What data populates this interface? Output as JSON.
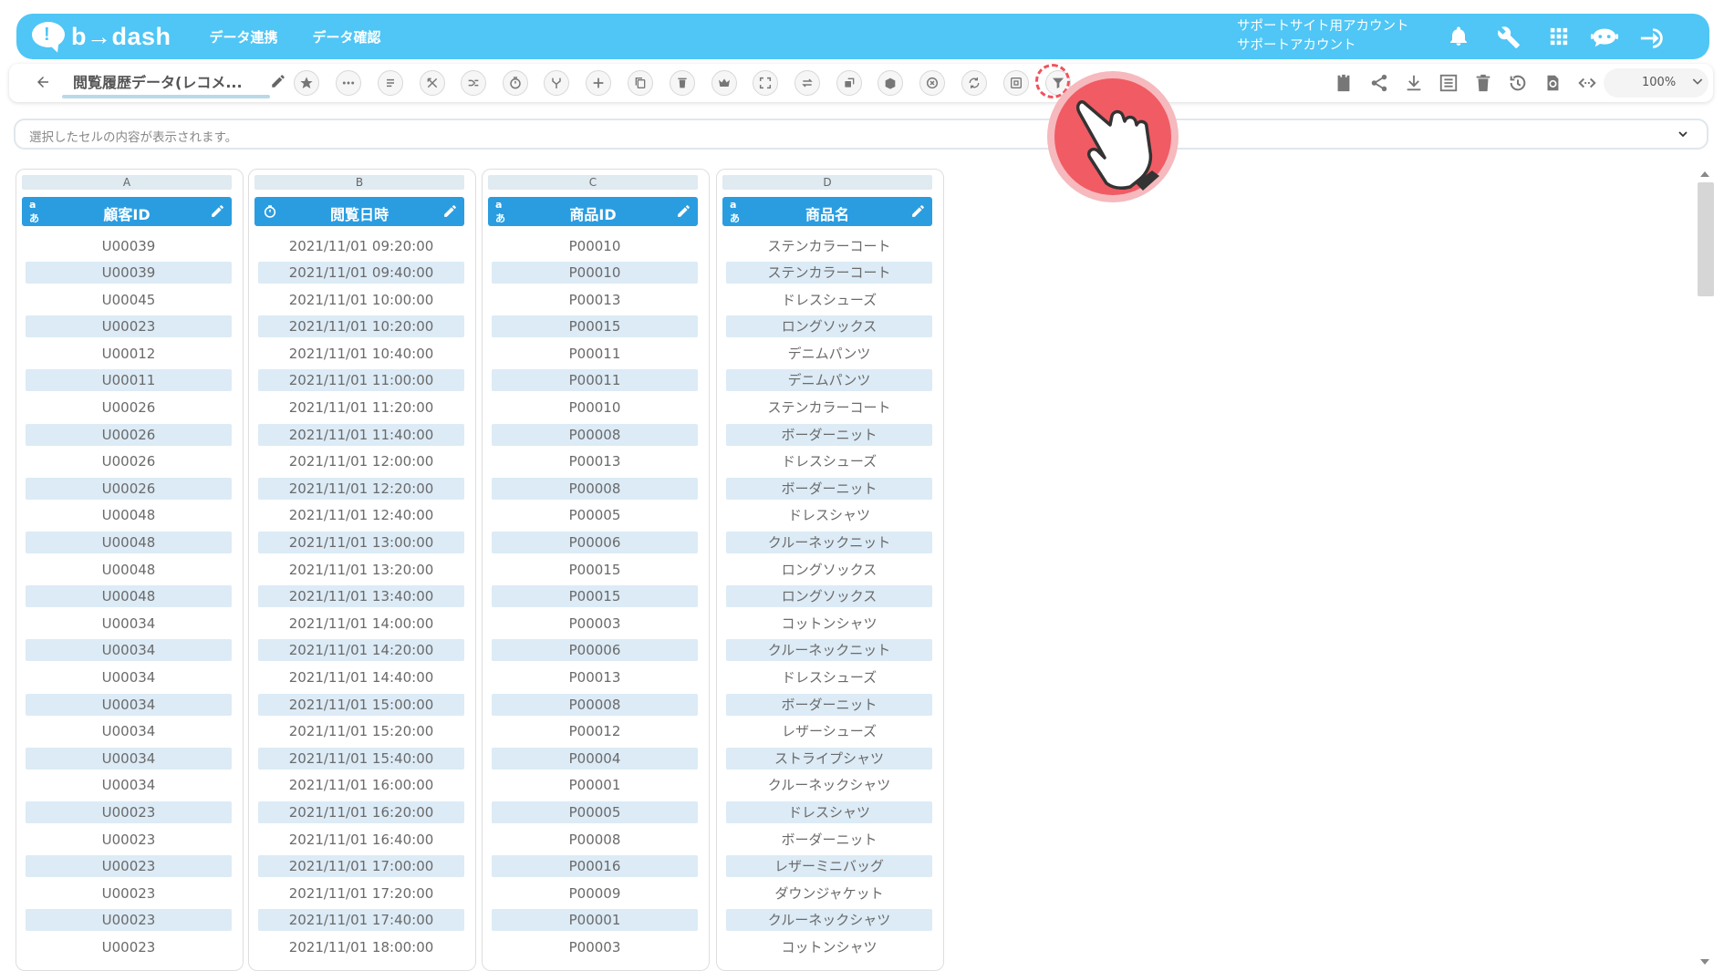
{
  "app": {
    "logo_text": "b→dash",
    "nav": [
      "データ連携",
      "データ確認"
    ],
    "account_line1": "サポートサイト用アカウント",
    "account_line2": "サポートアカウント",
    "brand_color": "#4fc6f5",
    "header_color": "#2a9de0",
    "top_icons": [
      "bell-icon",
      "wrench-icon",
      "grid-icon",
      "chat-bot-icon",
      "logout-icon"
    ]
  },
  "toolbar": {
    "title": "閲覧履歴データ(レコメ...",
    "tool_icons": [
      "star-icon",
      "more-icon",
      "lines-icon",
      "split-icon",
      "merge-icon",
      "timer-icon",
      "fork-icon",
      "add-icon",
      "copy-icon",
      "delete-icon",
      "crown-icon",
      "expand-icon",
      "swap-icon",
      "replace-icon",
      "box-icon",
      "cancel-icon",
      "convert-icon",
      "frame-icon",
      "filter-icon"
    ],
    "right_icons": [
      "clipboard-icon",
      "share-icon",
      "download-icon",
      "list-icon",
      "trash-icon",
      "history-icon",
      "refresh-icon",
      "code-icon"
    ],
    "zoom": "100%"
  },
  "cell_bar": {
    "placeholder": "選択したセルの内容が表示されます。"
  },
  "columns": [
    {
      "letter": "A",
      "type_icon": "text",
      "name": "顧客ID",
      "values": [
        "U00039",
        "U00039",
        "U00045",
        "U00023",
        "U00012",
        "U00011",
        "U00026",
        "U00026",
        "U00026",
        "U00026",
        "U00048",
        "U00048",
        "U00048",
        "U00048",
        "U00034",
        "U00034",
        "U00034",
        "U00034",
        "U00034",
        "U00034",
        "U00034",
        "U00023",
        "U00023",
        "U00023",
        "U00023",
        "U00023",
        "U00023"
      ]
    },
    {
      "letter": "B",
      "type_icon": "timer",
      "name": "閲覧日時",
      "values": [
        "2021/11/01 09:20:00",
        "2021/11/01 09:40:00",
        "2021/11/01 10:00:00",
        "2021/11/01 10:20:00",
        "2021/11/01 10:40:00",
        "2021/11/01 11:00:00",
        "2021/11/01 11:20:00",
        "2021/11/01 11:40:00",
        "2021/11/01 12:00:00",
        "2021/11/01 12:20:00",
        "2021/11/01 12:40:00",
        "2021/11/01 13:00:00",
        "2021/11/01 13:20:00",
        "2021/11/01 13:40:00",
        "2021/11/01 14:00:00",
        "2021/11/01 14:20:00",
        "2021/11/01 14:40:00",
        "2021/11/01 15:00:00",
        "2021/11/01 15:20:00",
        "2021/11/01 15:40:00",
        "2021/11/01 16:00:00",
        "2021/11/01 16:20:00",
        "2021/11/01 16:40:00",
        "2021/11/01 17:00:00",
        "2021/11/01 17:20:00",
        "2021/11/01 17:40:00",
        "2021/11/01 18:00:00"
      ]
    },
    {
      "letter": "C",
      "type_icon": "text",
      "name": "商品ID",
      "values": [
        "P00010",
        "P00010",
        "P00013",
        "P00015",
        "P00011",
        "P00011",
        "P00010",
        "P00008",
        "P00013",
        "P00008",
        "P00005",
        "P00006",
        "P00015",
        "P00015",
        "P00003",
        "P00006",
        "P00013",
        "P00008",
        "P00012",
        "P00004",
        "P00001",
        "P00005",
        "P00008",
        "P00016",
        "P00009",
        "P00001",
        "P00003"
      ]
    },
    {
      "letter": "D",
      "type_icon": "text",
      "name": "商品名",
      "values": [
        "ステンカラーコート",
        "ステンカラーコート",
        "ドレスシューズ",
        "ロングソックス",
        "デニムパンツ",
        "デニムパンツ",
        "ステンカラーコート",
        "ボーダーニット",
        "ドレスシューズ",
        "ボーダーニット",
        "ドレスシャツ",
        "クルーネックニット",
        "ロングソックス",
        "ロングソックス",
        "コットンシャツ",
        "クルーネックニット",
        "ドレスシューズ",
        "ボーダーニット",
        "レザーシューズ",
        "ストライプシャツ",
        "クルーネックシャツ",
        "ドレスシャツ",
        "ボーダーニット",
        "レザーミニバッグ",
        "ダウンジャケット",
        "クルーネックシャツ",
        "コットンシャツ"
      ]
    }
  ]
}
